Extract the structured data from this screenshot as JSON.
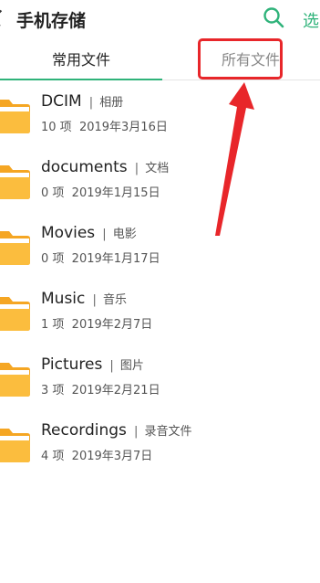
{
  "header": {
    "title": "手机存储",
    "select_label": "选"
  },
  "tabs": [
    {
      "label": "常用文件",
      "active": true
    },
    {
      "label": "所有文件",
      "active": false
    }
  ],
  "folders": [
    {
      "name": "DCIM",
      "separator": "|",
      "alias": "相册",
      "count": "10 项",
      "date": "2019年3月16日"
    },
    {
      "name": "documents",
      "separator": "|",
      "alias": "文档",
      "count": "0 项",
      "date": "2019年1月15日"
    },
    {
      "name": "Movies",
      "separator": "|",
      "alias": "电影",
      "count": "0 项",
      "date": "2019年1月17日"
    },
    {
      "name": "Music",
      "separator": "|",
      "alias": "音乐",
      "count": "1 项",
      "date": "2019年2月7日"
    },
    {
      "name": "Pictures",
      "separator": "|",
      "alias": "图片",
      "count": "3 项",
      "date": "2019年2月21日"
    },
    {
      "name": "Recordings",
      "separator": "|",
      "alias": "录音文件",
      "count": "4 项",
      "date": "2019年3月7日"
    }
  ],
  "icons": {
    "search": "search-icon",
    "folder": "folder-icon",
    "back": "back-chevron-icon"
  },
  "colors": {
    "accent": "#2fb37a",
    "highlight": "#e8262a",
    "folder_yellow": "#f9b533"
  }
}
